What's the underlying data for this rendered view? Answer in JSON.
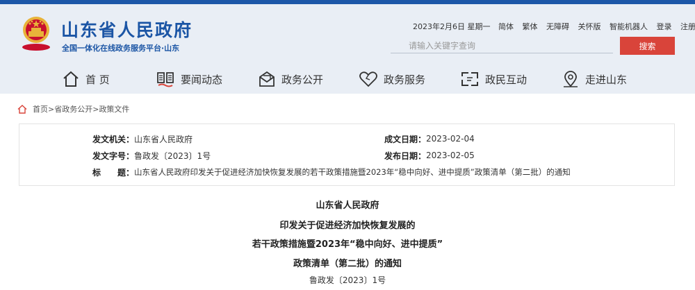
{
  "header": {
    "site_title": "山东省人民政府",
    "site_subtitle": "全国一体化在线政务服务平台·山东",
    "date": "2023年2月6日 星期一",
    "links": [
      "简体",
      "繁体",
      "无障碍",
      "关怀版",
      "智能机器人",
      "登录",
      "注册"
    ]
  },
  "search": {
    "placeholder": "请输入关键字查询",
    "button": "搜索"
  },
  "nav": [
    {
      "label": "首 页",
      "icon": "home-icon"
    },
    {
      "label": "要闻动态",
      "icon": "news-icon"
    },
    {
      "label": "政务公开",
      "icon": "mail-icon"
    },
    {
      "label": "政务服务",
      "icon": "heart-icon"
    },
    {
      "label": "政民互动",
      "icon": "interaction-icon"
    },
    {
      "label": "走进山东",
      "icon": "location-icon"
    }
  ],
  "breadcrumb": [
    "首页",
    "省政务公开",
    "政策文件"
  ],
  "meta": {
    "issuer_label": "发文机关：",
    "issuer": "山东省人民政府",
    "created_label": "成文日期：",
    "created": "2023-02-04",
    "doc_no_label": "发文字号：",
    "doc_no": "鲁政发〔2023〕1号",
    "published_label": "发布日期：",
    "published": "2023-02-05",
    "title_label": "标　　题：",
    "title": "山东省人民政府印发关于促进经济加快恢复发展的若干政策措施暨2023年“稳中向好、进中提质”政策清单（第二批）的通知"
  },
  "document": {
    "title_lines": [
      "山东省人民政府",
      "印发关于促进经济加快恢复发展的",
      "若干政策措施暨2023年“稳中向好、进中提质”",
      "政策清单（第二批）的通知"
    ],
    "doc_number": "鲁政发〔2023〕1号"
  },
  "colors": {
    "brand_blue": "#1b55a5",
    "header_bg": "#e9eef5",
    "search_button": "#d9443a"
  }
}
